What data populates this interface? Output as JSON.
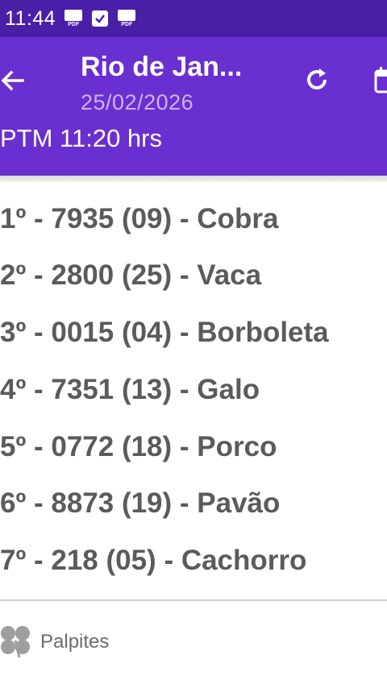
{
  "status_bar": {
    "time": "11:44",
    "icons": [
      "pdf-file-icon",
      "checkbox-icon",
      "pdf-file-icon"
    ],
    "pdf_tag": "PDF"
  },
  "app_bar": {
    "title": "Rio de Jan...",
    "date": "25/02/2026",
    "draw_time": "PTM 11:20 hrs",
    "icons": [
      "back-arrow-icon",
      "refresh-icon",
      "calendar-icon"
    ],
    "color": "#6a2fd0"
  },
  "results": [
    {
      "text": "1º - 7935 (09) - Cobra"
    },
    {
      "text": "2º - 2800 (25) - Vaca"
    },
    {
      "text": "3º - 0015 (04) - Borboleta"
    },
    {
      "text": "4º - 7351 (13) - Galo"
    },
    {
      "text": "5º - 0772 (18) - Porco"
    },
    {
      "text": "6º - 8873 (19) - Pavão"
    },
    {
      "text": "7º - 218 (05) - Cachorro"
    }
  ],
  "tips": {
    "label": "Palpites",
    "icon": "clover-icon"
  }
}
